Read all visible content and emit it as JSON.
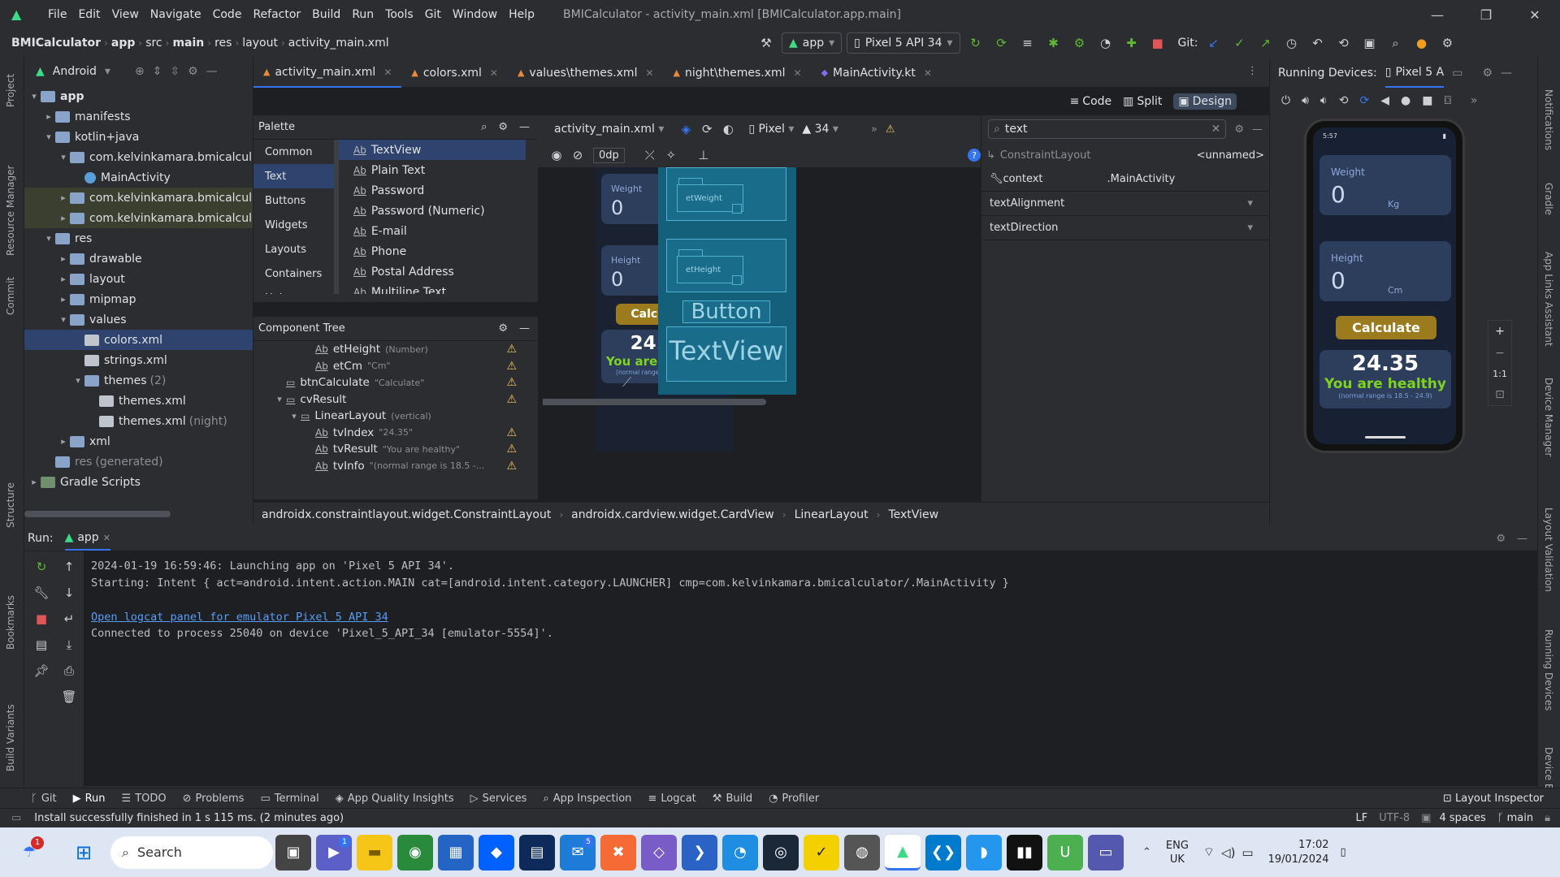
{
  "window": {
    "title": "BMICalculator - activity_main.xml [BMICalculator.app.main]"
  },
  "menu": [
    "File",
    "Edit",
    "View",
    "Navigate",
    "Code",
    "Refactor",
    "Build",
    "Run",
    "Tools",
    "Git",
    "Window",
    "Help"
  ],
  "breadcrumb": [
    "BMICalculator",
    "app",
    "src",
    "main",
    "res",
    "layout",
    "activity_main.xml"
  ],
  "toolbar": {
    "run_config": "app",
    "device": "Pixel 5 API 34",
    "git_label": "Git:"
  },
  "project": {
    "view_label": "Android",
    "tree": [
      {
        "label": "app",
        "indent": 0,
        "arrow": "▾",
        "type": "folder",
        "bold": true
      },
      {
        "label": "manifests",
        "indent": 1,
        "arrow": "▸",
        "type": "folder"
      },
      {
        "label": "kotlin+java",
        "indent": 1,
        "arrow": "▾",
        "type": "folder"
      },
      {
        "label": "com.kelvinkamara.bmicalcul",
        "indent": 2,
        "arrow": "▾",
        "type": "folder"
      },
      {
        "label": "MainActivity",
        "indent": 3,
        "arrow": "",
        "type": "kt"
      },
      {
        "label": "com.kelvinkamara.bmicalcul",
        "indent": 2,
        "arrow": "▸",
        "type": "folder",
        "hl": true
      },
      {
        "label": "com.kelvinkamara.bmicalcul",
        "indent": 2,
        "arrow": "▸",
        "type": "folder",
        "hl": true
      },
      {
        "label": "res",
        "indent": 1,
        "arrow": "▾",
        "type": "folder"
      },
      {
        "label": "drawable",
        "indent": 2,
        "arrow": "▸",
        "type": "folder"
      },
      {
        "label": "layout",
        "indent": 2,
        "arrow": "▸",
        "type": "folder"
      },
      {
        "label": "mipmap",
        "indent": 2,
        "arrow": "▸",
        "type": "folder"
      },
      {
        "label": "values",
        "indent": 2,
        "arrow": "▾",
        "type": "folder"
      },
      {
        "label": "colors.xml",
        "indent": 3,
        "arrow": "",
        "type": "file",
        "sel": true
      },
      {
        "label": "strings.xml",
        "indent": 3,
        "arrow": "",
        "type": "file"
      },
      {
        "label": "themes",
        "suffix": "(2)",
        "indent": 3,
        "arrow": "▾",
        "type": "folder"
      },
      {
        "label": "themes.xml",
        "indent": 4,
        "arrow": "",
        "type": "file"
      },
      {
        "label": "themes.xml",
        "suffix": "(night)",
        "indent": 4,
        "arrow": "",
        "type": "file"
      },
      {
        "label": "xml",
        "indent": 2,
        "arrow": "▸",
        "type": "folder"
      },
      {
        "label": "res",
        "suffix": "(generated)",
        "indent": 1,
        "arrow": "",
        "type": "folder",
        "dim": true
      },
      {
        "label": "Gradle Scripts",
        "indent": 0,
        "arrow": "▸",
        "type": "gradle"
      }
    ]
  },
  "tabs": [
    {
      "label": "activity_main.xml",
      "active": true
    },
    {
      "label": "colors.xml"
    },
    {
      "label": "values\\themes.xml"
    },
    {
      "label": "night\\themes.xml"
    },
    {
      "label": "MainActivity.kt"
    }
  ],
  "view_modes": {
    "code": "Code",
    "split": "Split",
    "design": "Design"
  },
  "palette": {
    "title": "Palette",
    "categories": [
      "Common",
      "Text",
      "Buttons",
      "Widgets",
      "Layouts",
      "Containers",
      "Helpers"
    ],
    "items": [
      "TextView",
      "Plain Text",
      "Password",
      "Password (Numeric)",
      "E-mail",
      "Phone",
      "Postal Address",
      "Multiline Text"
    ]
  },
  "component_tree": {
    "title": "Component Tree",
    "rows": [
      {
        "label": "etHeight",
        "hint": "(Number)",
        "indent": 3,
        "warn": true
      },
      {
        "label": "etCm",
        "hint": "\"Cm\"",
        "indent": 3,
        "warn": true
      },
      {
        "label": "btnCalculate",
        "hint": "\"Calculate\"",
        "indent": 1,
        "warn": true
      },
      {
        "label": "cvResult",
        "hint": "",
        "indent": 1,
        "warn": true,
        "arrow": "▾"
      },
      {
        "label": "LinearLayout",
        "hint": "(vertical)",
        "indent": 2,
        "arrow": "▾"
      },
      {
        "label": "tvIndex",
        "hint": "\"24.35\"",
        "indent": 3,
        "warn": true
      },
      {
        "label": "tvResult",
        "hint": "\"You are healthy\"",
        "indent": 3,
        "warn": true
      },
      {
        "label": "tvInfo",
        "hint": "\"(normal range is 18.5 -...",
        "indent": 3,
        "warn": true
      }
    ]
  },
  "design_bar": {
    "file": "activity_main.xml",
    "device": "Pixel",
    "api": "34",
    "margin": "0dp"
  },
  "attributes": {
    "search": "text",
    "component": "ConstraintLayout",
    "component_id": "<unnamed>",
    "rows": [
      {
        "key": "context",
        "value": ".MainActivity"
      },
      {
        "key": "textAlignment",
        "value": ""
      },
      {
        "key": "textDirection",
        "value": ""
      }
    ]
  },
  "app_preview": {
    "weight_label": "Weight",
    "weight_value": "0",
    "weight_unit": "Kg",
    "height_label": "Height",
    "height_value": "0",
    "height_unit": "Cm",
    "button": "Calculate",
    "index": "24.35",
    "result": "You are healthy",
    "info": "(normal range is 18.5 - 24.9)"
  },
  "blueprint": {
    "et_weight": "etWeight",
    "et_height": "etHeight",
    "button": "Button",
    "textview": "TextView"
  },
  "running_devices": {
    "title": "Running Devices:",
    "device_tab": "Pixel 5 A",
    "status_time": "5:57",
    "zoom": "1:1"
  },
  "bottom_crumbs": [
    "androidx.constraintlayout.widget.ConstraintLayout",
    "androidx.cardview.widget.CardView",
    "LinearLayout",
    "TextView"
  ],
  "run": {
    "label": "Run:",
    "config": "app",
    "lines": [
      "2024-01-19 16:59:46: Launching app on 'Pixel 5 API 34'.",
      "Starting: Intent { act=android.intent.action.MAIN cat=[android.intent.category.LAUNCHER] cmp=com.kelvinkamara.bmicalculator/.MainActivity }",
      "",
      "Connected to process 25040 on device 'Pixel_5_API_34 [emulator-5554]'."
    ],
    "link": "Open logcat panel for emulator Pixel 5 API 34"
  },
  "bottom_tools": [
    "Git",
    "Run",
    "TODO",
    "Problems",
    "Terminal",
    "App Quality Insights",
    "Services",
    "App Inspection",
    "Logcat",
    "Build",
    "Profiler"
  ],
  "layout_inspector": "Layout Inspector",
  "status": {
    "message": "Install successfully finished in 1 s 115 ms. (2 minutes ago)",
    "lf": "LF",
    "encoding": "UTF-8",
    "indent": "4 spaces",
    "branch": "main"
  },
  "left_strip": [
    "Project",
    "Resource Manager",
    "Commit",
    "Structure",
    "Bookmarks",
    "Build Variants"
  ],
  "right_strip": [
    "Notifications",
    "Gradle",
    "App Links Assistant",
    "Device Manager",
    "Layout Validation",
    "Running Devices",
    "Device Explorer"
  ],
  "taskbar": {
    "search": "Search",
    "lang1": "ENG",
    "lang2": "UK",
    "time": "17:02",
    "date": "19/01/2024",
    "badge1": "1",
    "badge2": "1",
    "badge3": "5"
  },
  "colors": {
    "accent": "#3574f0",
    "card": "#2c3e5b",
    "button": "#9c7a1e",
    "healthy": "#7ed321",
    "warn": "#f2c55c"
  }
}
